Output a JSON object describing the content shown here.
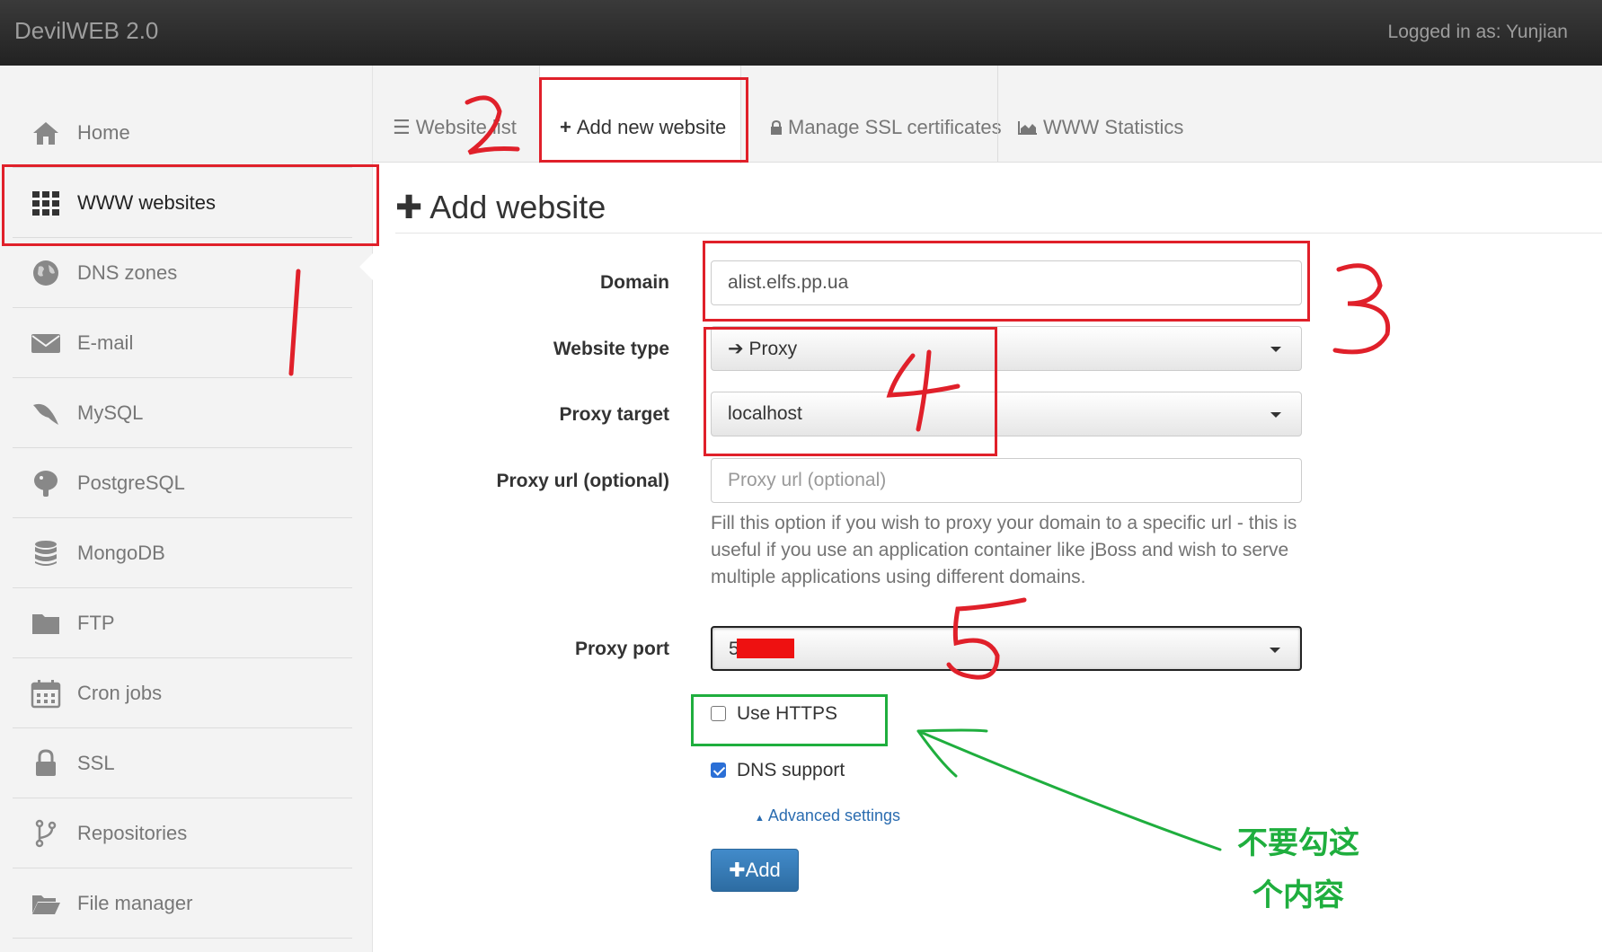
{
  "app": {
    "title": "DevilWEB 2.0",
    "login_text": "Logged in as: Yunjian"
  },
  "sidebar": {
    "items": [
      {
        "label": "Home",
        "icon": "home-icon"
      },
      {
        "label": "WWW websites",
        "icon": "grid-icon",
        "active": true
      },
      {
        "label": "DNS zones",
        "icon": "globe-icon"
      },
      {
        "label": "E-mail",
        "icon": "envelope-icon"
      },
      {
        "label": "MySQL",
        "icon": "dolphin-icon"
      },
      {
        "label": "PostgreSQL",
        "icon": "elephant-icon"
      },
      {
        "label": "MongoDB",
        "icon": "database-icon"
      },
      {
        "label": "FTP",
        "icon": "folder-icon"
      },
      {
        "label": "Cron jobs",
        "icon": "calendar-icon"
      },
      {
        "label": "SSL",
        "icon": "lock-icon"
      },
      {
        "label": "Repositories",
        "icon": "branch-icon"
      },
      {
        "label": "File manager",
        "icon": "folder-open-icon"
      }
    ]
  },
  "tabs": [
    {
      "label": "Website list",
      "icon": "list-icon"
    },
    {
      "label": "Add new website",
      "icon": "plus-icon",
      "active": true
    },
    {
      "label": "Manage SSL certificates",
      "icon": "lock-icon"
    },
    {
      "label": "WWW Statistics",
      "icon": "area-chart-icon"
    }
  ],
  "form": {
    "title": "Add website",
    "domain": {
      "label": "Domain",
      "value": "alist.elfs.pp.ua"
    },
    "website_type": {
      "label": "Website type",
      "value": "Proxy"
    },
    "proxy_target": {
      "label": "Proxy target",
      "value": "localhost"
    },
    "proxy_url": {
      "label": "Proxy url (optional)",
      "placeholder": "Proxy url (optional)",
      "help": "Fill this option if you wish to proxy your domain to a specific url - this is useful if you use an application container like jBoss and wish to serve multiple applications using different domains."
    },
    "proxy_port": {
      "label": "Proxy port",
      "value": "5"
    },
    "use_https": {
      "label": "Use HTTPS",
      "checked": false
    },
    "dns_support": {
      "label": "DNS support",
      "checked": true
    },
    "advanced_link": "Advanced settings",
    "submit_label": "Add"
  },
  "annotations": {
    "step_numbers": [
      "1",
      "2",
      "3",
      "4",
      "5"
    ],
    "note": "不要勾这个内容",
    "red_color": "#e0202a",
    "green_color": "#1fae3e"
  }
}
